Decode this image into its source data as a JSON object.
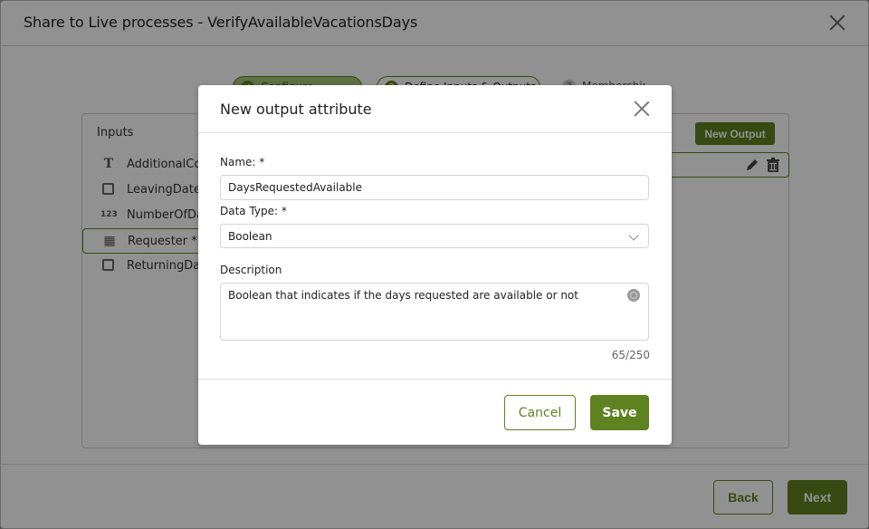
{
  "window": {
    "title": "Share to Live processes - VerifyAvailableVacationsDays",
    "close_icon": "close-icon"
  },
  "stepper": {
    "steps": [
      {
        "label": "Configure",
        "marker": "✓",
        "state": "done"
      },
      {
        "label": "Define Inputs & Outputs",
        "marker": "2",
        "state": "active"
      },
      {
        "label": "Membership",
        "marker": "3",
        "state": "pending"
      }
    ]
  },
  "inputs_panel": {
    "title": "Inputs",
    "items": [
      {
        "label": "AdditionalComments",
        "icon": "text-type-icon",
        "glyph": "T"
      },
      {
        "label": "LeavingDate *",
        "icon": "calendar-icon",
        "glyph": ""
      },
      {
        "label": "NumberOfDays",
        "icon": "number-type-icon",
        "glyph": "123"
      },
      {
        "label": "Requester *",
        "icon": "entity-icon",
        "glyph": "▦",
        "selected": true
      },
      {
        "label": "ReturningDate",
        "icon": "calendar-icon",
        "glyph": ""
      }
    ]
  },
  "outputs_panel": {
    "new_output_label": "New Output",
    "row_actions": [
      "edit-icon",
      "trash-icon"
    ]
  },
  "footer": {
    "back_label": "Back",
    "next_label": "Next"
  },
  "modal": {
    "title": "New output attribute",
    "name_label": "Name: *",
    "name_value": "DaysRequestedAvailable",
    "data_type_label": "Data Type: *",
    "data_type_value": "Boolean",
    "description_label": "Description",
    "description_value": "Boolean that indicates if the days requested are available or not",
    "char_count": "65/250",
    "cancel_label": "Cancel",
    "save_label": "Save"
  },
  "colors": {
    "accent": "#5f8220",
    "overlay": "#909090"
  }
}
